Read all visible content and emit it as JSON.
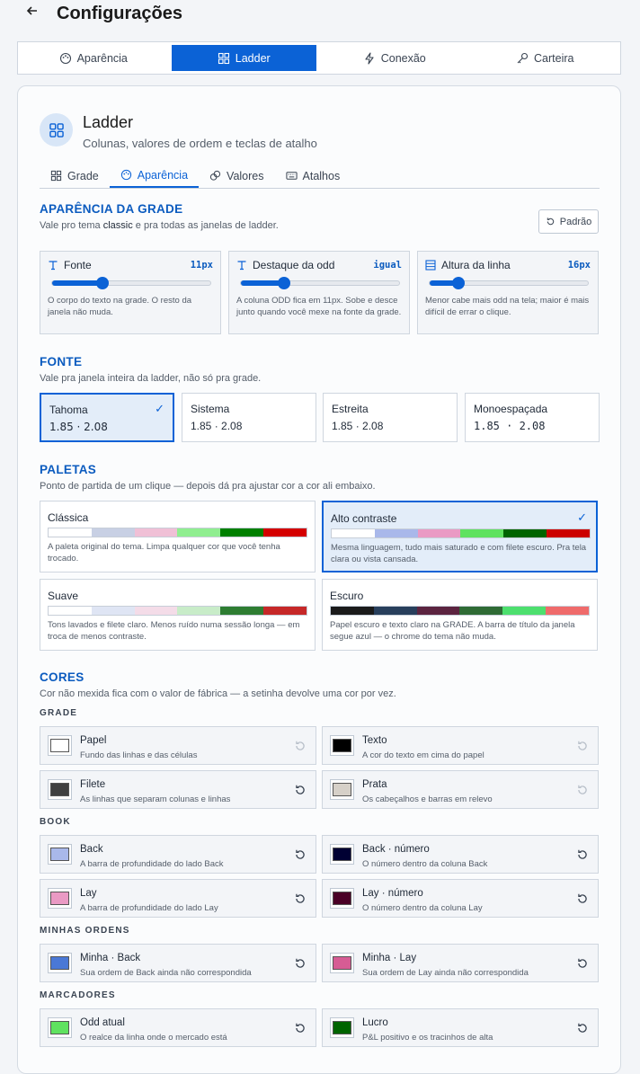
{
  "header": {
    "back_icon": "arrow-left-icon",
    "title": "Configurações"
  },
  "main_tabs": [
    {
      "label": "Aparência",
      "icon": "palette-icon"
    },
    {
      "label": "Ladder",
      "icon": "grid-icon"
    },
    {
      "label": "Conexão",
      "icon": "bolt-icon"
    },
    {
      "label": "Carteira",
      "icon": "key-icon"
    }
  ],
  "section": {
    "title": "Ladder",
    "subtitle": "Colunas, valores de ordem e teclas de atalho"
  },
  "sub_tabs": [
    {
      "label": "Grade"
    },
    {
      "label": "Aparência"
    },
    {
      "label": "Valores"
    },
    {
      "label": "Atalhos"
    }
  ],
  "grid_appearance": {
    "title": "APARÊNCIA DA GRADE",
    "desc_pre": "Vale pro tema ",
    "desc_theme": "classic",
    "desc_post": " e pra todas as janelas de ladder.",
    "reset_label": "Padrão",
    "sliders": [
      {
        "label": "Fonte",
        "value": "11px",
        "level": 0.32,
        "desc": "O corpo do texto na grade. O resto da janela não muda."
      },
      {
        "label": "Destaque da odd",
        "value": "igual",
        "level": 0.27,
        "desc": "A coluna ODD fica em 11px. Sobe e desce junto quando você mexe na fonte da grade."
      },
      {
        "label": "Altura da linha",
        "value": "16px",
        "level": 0.18,
        "desc": "Menor cabe mais odd na tela; maior é mais difícil de errar o clique."
      }
    ]
  },
  "font": {
    "title": "FONTE",
    "desc": "Vale pra janela inteira da ladder, não só pra grade.",
    "options": [
      {
        "name": "Tahoma",
        "sample": "1.85 · 2.08",
        "selected": true
      },
      {
        "name": "Sistema",
        "sample": "1.85 · 2.08",
        "selected": false
      },
      {
        "name": "Estreita",
        "sample": "1.85 · 2.08",
        "selected": false
      },
      {
        "name": "Monoespaçada",
        "sample": "1.85 · 2.08",
        "selected": false
      }
    ]
  },
  "palettes": {
    "title": "PALETAS",
    "desc": "Ponto de partida de um clique — depois dá pra ajustar cor a cor ali embaixo.",
    "items": [
      {
        "name": "Clássica",
        "selected": false,
        "colors": [
          "#ffffff",
          "#c8d0e4",
          "#f0c0d6",
          "#90ee90",
          "#008000",
          "#d40000"
        ],
        "desc": "A paleta original do tema. Limpa qualquer cor que você tenha trocado."
      },
      {
        "name": "Alto contraste",
        "selected": true,
        "colors": [
          "#ffffff",
          "#a9b8ea",
          "#ea9ac4",
          "#5fe25f",
          "#006400",
          "#cc0000"
        ],
        "desc": "Mesma linguagem, tudo mais saturado e com filete escuro. Pra tela clara ou vista cansada."
      },
      {
        "name": "Suave",
        "selected": false,
        "colors": [
          "#ffffff",
          "#dfe5f4",
          "#f4dce8",
          "#c8ecc8",
          "#2e7d32",
          "#c62828"
        ],
        "desc": "Tons lavados e filete claro. Menos ruído numa sessão longa — em troca de menos contraste."
      },
      {
        "name": "Escuro",
        "selected": false,
        "colors": [
          "#1b1b1b",
          "#283f5c",
          "#5c2440",
          "#2f6b35",
          "#4ddf6e",
          "#ef6b6b"
        ],
        "desc": "Papel escuro e texto claro na GRADE. A barra de título da janela segue azul — o chrome do tema não muda."
      }
    ]
  },
  "colors": {
    "title": "CORES",
    "desc": "Cor não mexida fica com o valor de fábrica — a setinha devolve uma cor por vez.",
    "groups": [
      {
        "label": "GRADE",
        "items": [
          {
            "name": "Papel",
            "desc": "Fundo das linhas e das células",
            "color": "#ffffff",
            "changed": false
          },
          {
            "name": "Texto",
            "desc": "A cor do texto em cima do papel",
            "color": "#000000",
            "changed": false
          },
          {
            "name": "Filete",
            "desc": "As linhas que separam colunas e linhas",
            "color": "#404040",
            "changed": true
          },
          {
            "name": "Prata",
            "desc": "Os cabeçalhos e barras em relevo",
            "color": "#d6d0c8",
            "changed": false
          }
        ]
      },
      {
        "label": "BOOK",
        "items": [
          {
            "name": "Back",
            "desc": "A barra de profundidade do lado Back",
            "color": "#a9b8ea",
            "changed": true
          },
          {
            "name": "Back · número",
            "desc": "O número dentro da coluna Back",
            "color": "#000033",
            "changed": true
          },
          {
            "name": "Lay",
            "desc": "A barra de profundidade do lado Lay",
            "color": "#ea9ac4",
            "changed": true
          },
          {
            "name": "Lay · número",
            "desc": "O número dentro da coluna Lay",
            "color": "#4a0026",
            "changed": true
          }
        ]
      },
      {
        "label": "MINHAS ORDENS",
        "items": [
          {
            "name": "Minha · Back",
            "desc": "Sua ordem de Back ainda não correspondida",
            "color": "#4a78d6",
            "changed": true
          },
          {
            "name": "Minha · Lay",
            "desc": "Sua ordem de Lay ainda não correspondida",
            "color": "#d65c94",
            "changed": true
          }
        ]
      },
      {
        "label": "MARCADORES",
        "items": [
          {
            "name": "Odd atual",
            "desc": "O realce da linha onde o mercado está",
            "color": "#5fe25f",
            "changed": true
          },
          {
            "name": "Lucro",
            "desc": "P&L positivo e os tracinhos de alta",
            "color": "#006400",
            "changed": true
          }
        ]
      }
    ]
  },
  "accent": "#0b62d6"
}
